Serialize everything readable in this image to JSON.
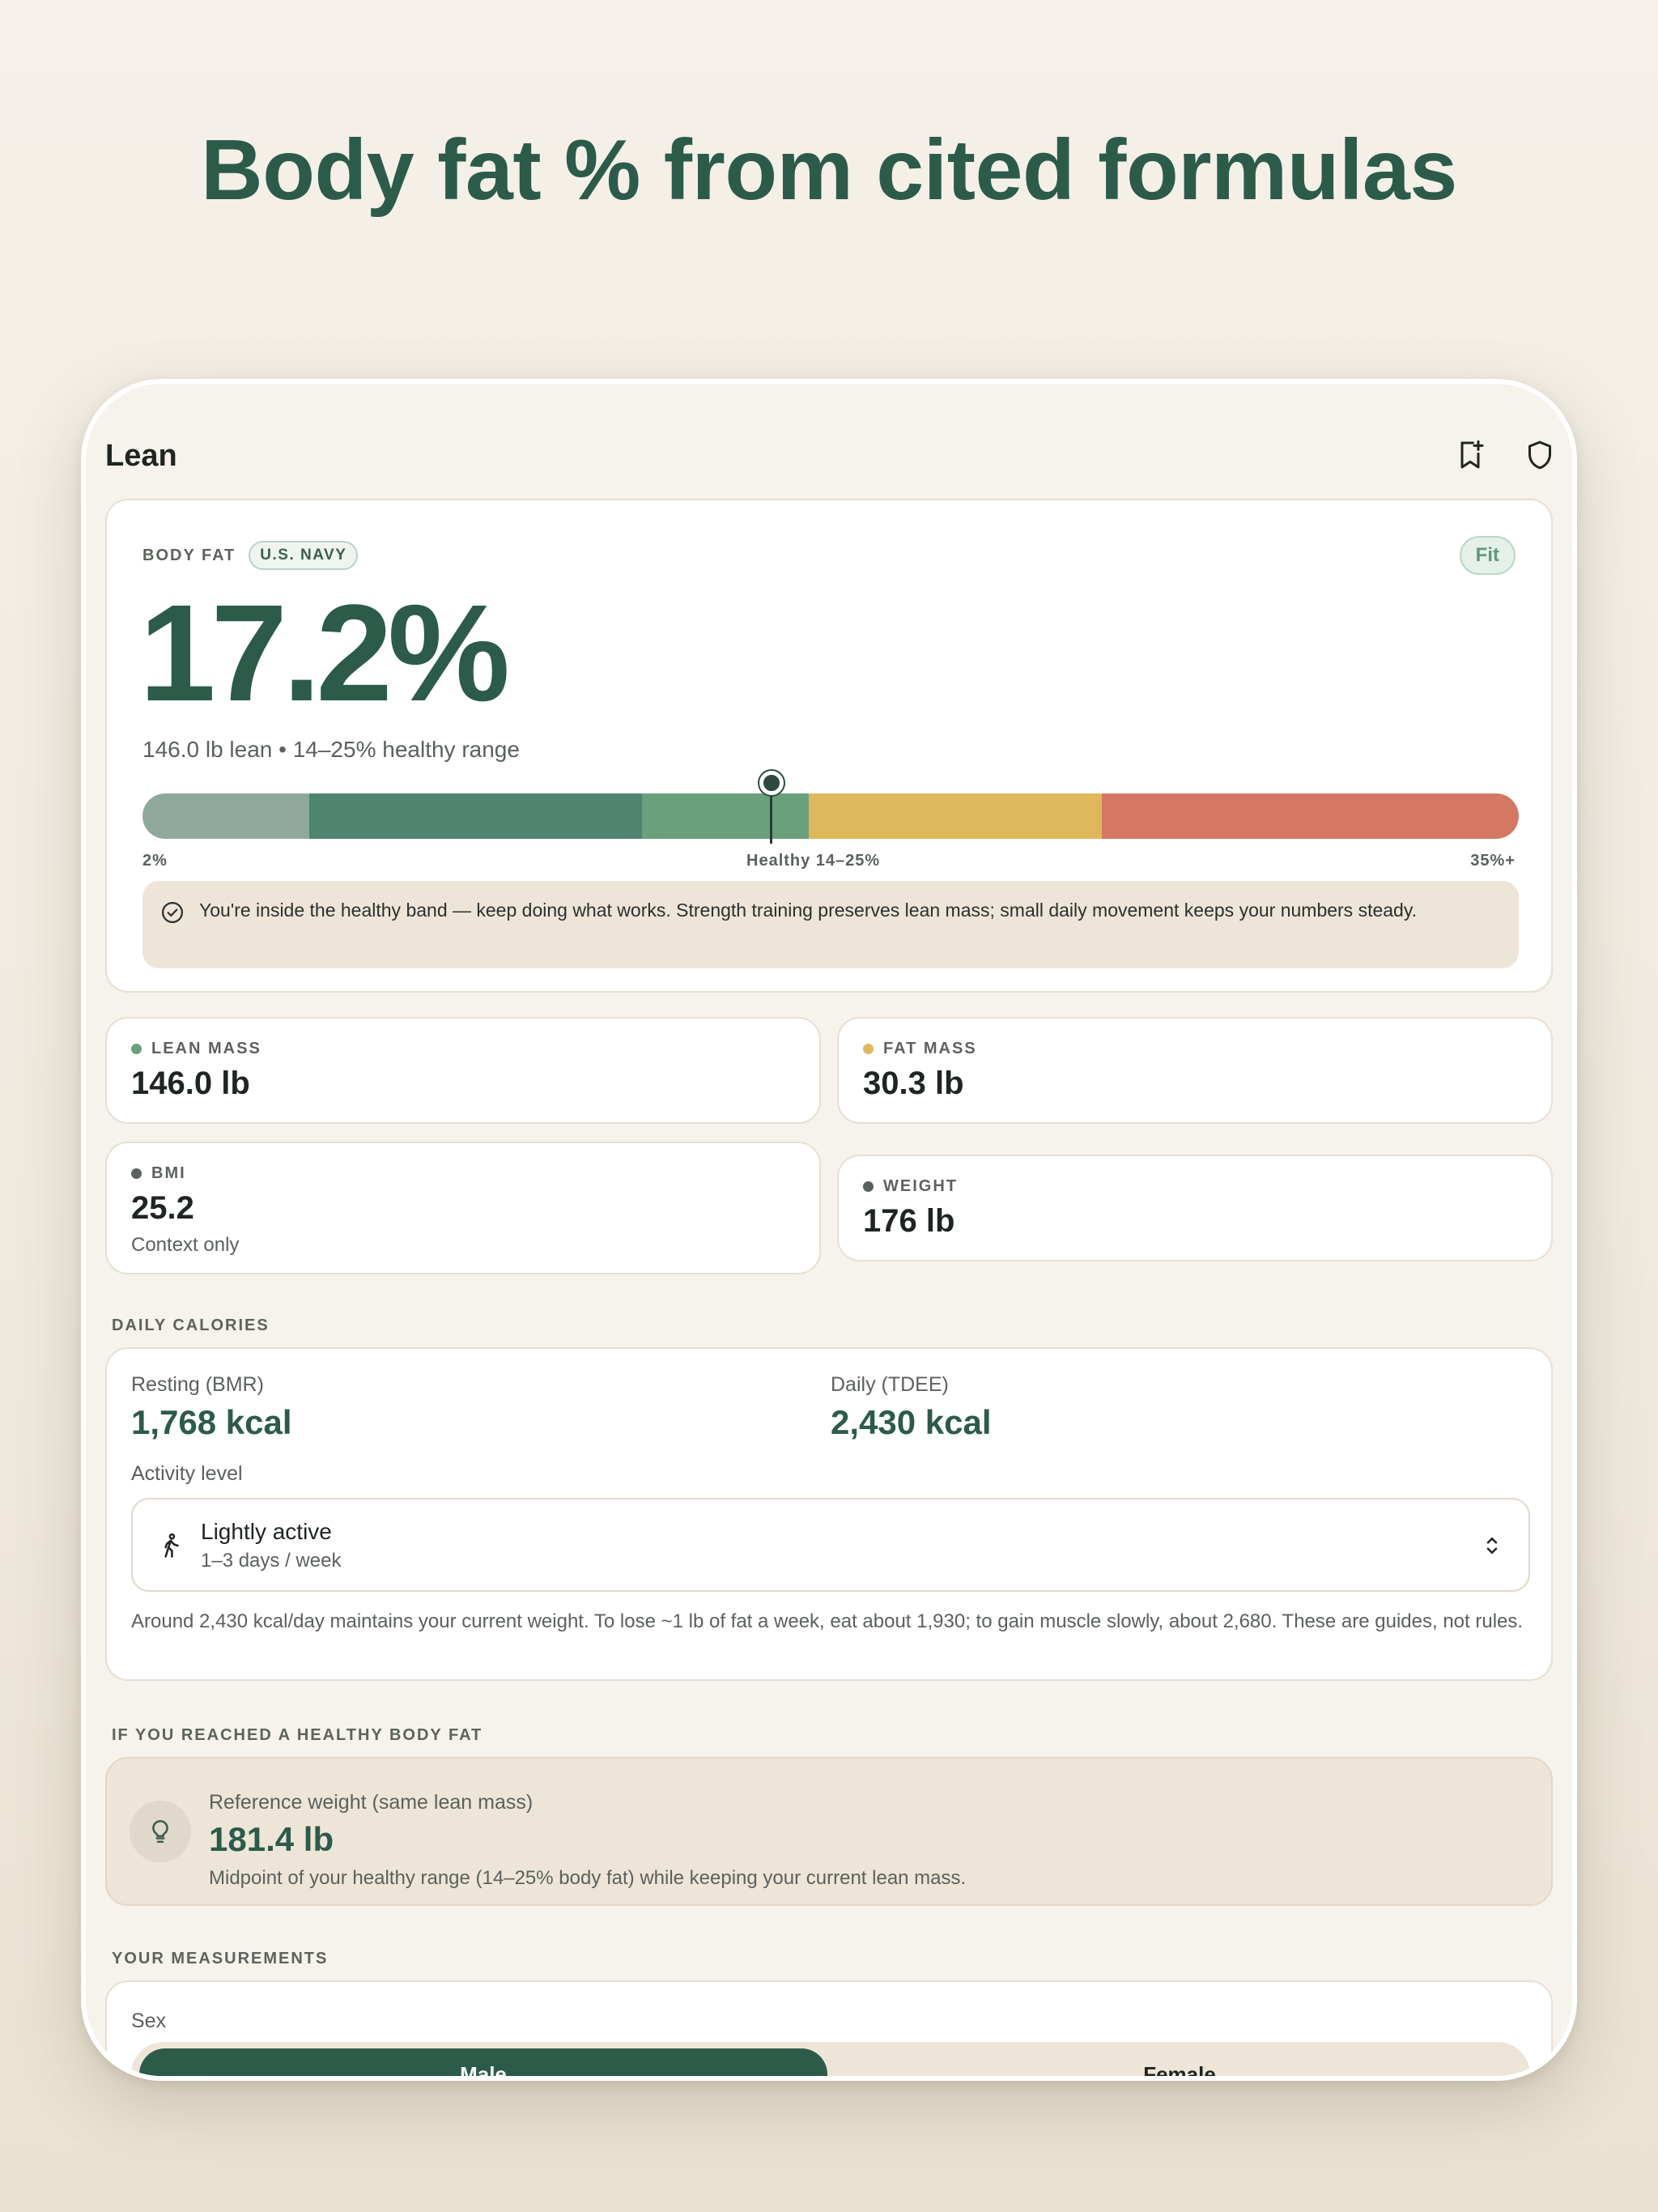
{
  "headline": "Body fat % from cited formulas",
  "app": {
    "title": "Lean"
  },
  "icons": {
    "bookmark": "bookmark-add-icon",
    "shield": "shield-icon"
  },
  "body_fat": {
    "label": "BODY FAT",
    "method": "U.S. NAVY",
    "value": "17.2%",
    "category": "Fit",
    "summary": "146.0 lb lean • 14–25% healthy range",
    "scale_min": "2%",
    "scale_healthy": "Healthy 14–25%",
    "scale_max": "35%+",
    "marker_fraction": 0.457,
    "scale_colors": [
      "#8fa89c",
      "#4e8470",
      "#6aa07c",
      "#e0b85c",
      "#d47763"
    ],
    "note": "You're inside the healthy band — keep doing what works. Strength training preserves lean mass; small daily movement keeps your numbers steady."
  },
  "stats": [
    {
      "label": "LEAN MASS",
      "value": "146.0 lb",
      "color": "#6aa07c"
    },
    {
      "label": "FAT MASS",
      "value": "30.3 lb",
      "color": "#e0b85c"
    },
    {
      "label": "BMI",
      "value": "25.2",
      "context": "Context only",
      "color": "#5b615c"
    },
    {
      "label": "WEIGHT",
      "value": "176 lb",
      "color": "#5b615c"
    }
  ],
  "calories": {
    "section": "DAILY CALORIES",
    "bmr_label": "Resting (BMR)",
    "bmr_value": "1,768 kcal",
    "tdee_label": "Daily (TDEE)",
    "tdee_value": "2,430 kcal",
    "activity_label": "Activity level",
    "activity_value": "Lightly active",
    "activity_detail": "1–3 days / week",
    "description": "Around 2,430 kcal/day maintains your current weight. To lose ~1 lb of fat a week, eat about 1,930; to gain muscle slowly, about 2,680. These are guides, not rules."
  },
  "reference": {
    "section": "IF YOU REACHED A HEALTHY BODY FAT",
    "label": "Reference weight (same lean mass)",
    "value": "181.4 lb",
    "description": "Midpoint of your healthy range (14–25% body fat) while keeping your current lean mass."
  },
  "measurements": {
    "section": "YOUR MEASUREMENTS",
    "sex_label": "Sex",
    "options": [
      "Male",
      "Female"
    ],
    "selected": "Male"
  }
}
